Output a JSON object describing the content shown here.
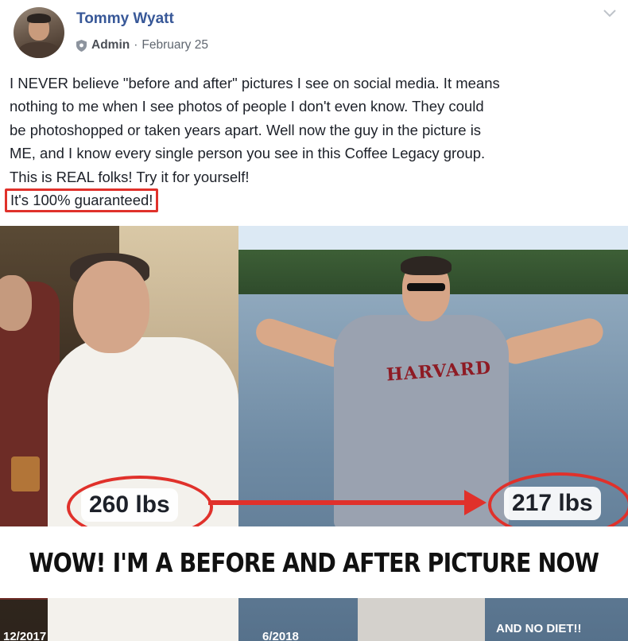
{
  "post": {
    "author_name": "Tommy Wyatt",
    "role": "Admin",
    "separator": "·",
    "date": "February 25",
    "body_lines": [
      "I NEVER believe \"before and after\" pictures I see on social media. It means",
      "nothing to me when I see photos of people I don't even know. They could",
      "be photoshopped or taken years apart. Well now the guy in the picture is",
      "ME, and I know every single person you see in this Coffee Legacy group.",
      "This is REAL folks! Try it for yourself!"
    ],
    "highlighted_line": "It's 100% guaranteed!"
  },
  "photo": {
    "weight_before": "260 lbs",
    "weight_after": "217 lbs",
    "shirt_text": "HARVARD",
    "banner": "WOW! I'M A BEFORE AND AFTER PICTURE NOW",
    "date_before": "12/2017",
    "date_after": "6/2018",
    "caption": "AND NO DIET!!"
  },
  "colors": {
    "link": "#385898",
    "highlight": "#e0312b",
    "text": "#1d2129",
    "meta": "#606770"
  },
  "icons": {
    "role_icon": "shield-icon",
    "menu_icon": "chevron-down-icon"
  }
}
